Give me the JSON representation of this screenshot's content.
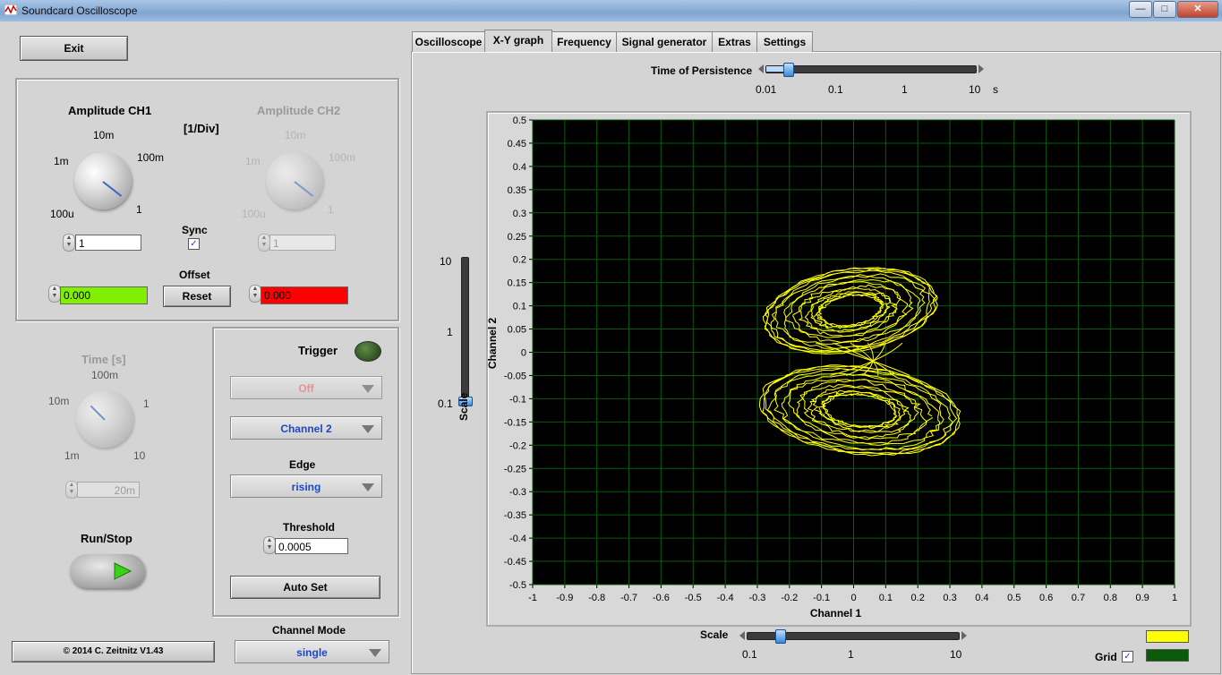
{
  "window": {
    "title": "Soundcard Oscilloscope",
    "min": "—",
    "max": "□",
    "close": "✕"
  },
  "left": {
    "exit": "Exit",
    "amp_ch1": "Amplitude CH1",
    "amp_unit": "[1/Div]",
    "amp_ch2": "Amplitude CH2",
    "knob_labels": [
      "100u",
      "1m",
      "10m",
      "100m",
      "1"
    ],
    "ch1_value": "1",
    "ch2_value": "1",
    "sync": "Sync",
    "offset": "Offset",
    "reset": "Reset",
    "offset_ch1": "0.000",
    "offset_ch2": "0.000",
    "time_label": "Time [s]",
    "time_knob_labels": [
      "1m",
      "10m",
      "100m",
      "1",
      "10"
    ],
    "time_value": "20m",
    "run_stop": "Run/Stop",
    "copyright": "© 2014  C. Zeitnitz V1.43"
  },
  "trigger": {
    "label": "Trigger",
    "mode": "Off",
    "channel": "Channel 2",
    "edge_label": "Edge",
    "edge": "rising",
    "threshold_label": "Threshold",
    "threshold": "0.0005",
    "auto_set": "Auto Set",
    "channel_mode_label": "Channel Mode",
    "channel_mode": "single"
  },
  "tabs": [
    "Oscilloscope",
    "X-Y graph",
    "Frequency",
    "Signal generator",
    "Extras",
    "Settings"
  ],
  "active_tab": 1,
  "persistence": {
    "label": "Time of Persistence",
    "ticks": [
      "0.01",
      "0.1",
      "1",
      "10"
    ],
    "unit": "s",
    "value": 0.02
  },
  "vscale": {
    "label": "Scale",
    "ticks": [
      "10",
      "1",
      "0.1"
    ],
    "value": 0.1
  },
  "hscale": {
    "label": "Scale",
    "ticks": [
      "0.1",
      "1",
      "10"
    ],
    "value": 0.2
  },
  "grid": {
    "label": "Grid",
    "checked": true
  },
  "colors": {
    "trace": "#ffff00",
    "grid": "#0a5a0a",
    "plot_bg": "#000000",
    "ch1_offset": "#80f000",
    "ch2_offset": "#ff0000"
  },
  "chart_data": {
    "type": "scatter",
    "xlabel": "Channel 1",
    "ylabel": "Channel 2",
    "xlim": [
      -1,
      1
    ],
    "ylim": [
      -0.5,
      0.5
    ],
    "grid": true,
    "x_ticks": [
      "-1",
      "-0.9",
      "-0.8",
      "-0.7",
      "-0.6",
      "-0.5",
      "-0.4",
      "-0.3",
      "-0.2",
      "-0.1",
      "0",
      "0.1",
      "0.2",
      "0.3",
      "0.4",
      "0.5",
      "0.6",
      "0.7",
      "0.8",
      "0.9",
      "1"
    ],
    "y_ticks": [
      "0.5",
      "0.45",
      "0.4",
      "0.35",
      "0.3",
      "0.25",
      "0.2",
      "0.15",
      "0.1",
      "0.05",
      "0",
      "-0.05",
      "-0.1",
      "-0.15",
      "-0.2",
      "-0.25",
      "-0.3",
      "-0.35",
      "-0.4",
      "-0.45",
      "-0.5"
    ],
    "series": [
      {
        "lobe": "upper",
        "center": [
          0.0,
          0.1
        ],
        "x_range": [
          -0.28,
          0.26
        ],
        "y_range": [
          -0.01,
          0.19
        ]
      },
      {
        "lobe": "lower",
        "center": [
          0.0,
          -0.15
        ],
        "x_range": [
          -0.29,
          0.33
        ],
        "y_range": [
          -0.23,
          -0.02
        ]
      }
    ]
  }
}
